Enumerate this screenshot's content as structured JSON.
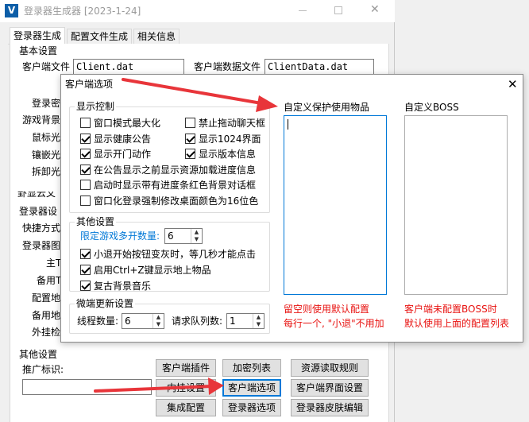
{
  "main_window": {
    "title": "登录器生成器 [2023-1-24]",
    "app_icon_letter": "V",
    "tabs": [
      "登录器生成",
      "配置文件生成",
      "相关信息"
    ],
    "basic_settings_title": "基本设置",
    "client_file_label": "客户端文件",
    "client_file_value": "Client.dat",
    "client_data_label": "客户端数据文件",
    "client_data_value": "ClientData.dat",
    "partial_labels": [
      "登录密",
      "游戏背景",
      "鼠标光",
      "镶嵌光",
      "拆卸光",
      "登录器设",
      "快捷方式",
      "登录器图",
      "主T",
      "备用T",
      "配置地",
      "备用地",
      "外挂检"
    ],
    "cut_section_title": "卦显云文",
    "other_settings_title": "其他设置",
    "promo_label": "推广标识:",
    "buttons": {
      "client_plugin": "客户端插件",
      "encrypt_list": "加密列表",
      "resource_rules": "资源读取规则",
      "inner_settings": "内挂设置",
      "client_options": "客户端选项",
      "client_ui_settings": "客户端界面设置",
      "integrated_config": "集成配置",
      "launcher_options": "登录器选项",
      "launcher_skin_edit": "登录器皮肤编辑"
    }
  },
  "dialog": {
    "title": "客户端选项",
    "display_control": {
      "title": "显示控制",
      "items": [
        {
          "label": "窗口模式最大化",
          "checked": false
        },
        {
          "label": "禁止拖动聊天框",
          "checked": false
        },
        {
          "label": "显示健康公告",
          "checked": true
        },
        {
          "label": "显示1024界面",
          "checked": true
        },
        {
          "label": "显示开门动作",
          "checked": true
        },
        {
          "label": "显示版本信息",
          "checked": true
        },
        {
          "label": "在公告显示之前显示资源加载进度信息",
          "checked": true
        },
        {
          "label": "启动时显示带有进度条红色背景对话框",
          "checked": false
        },
        {
          "label": "窗口化登录强制修改桌面颜色为16位色",
          "checked": false
        }
      ]
    },
    "other_settings": {
      "title": "其他设置",
      "limit_label": "限定游戏多开数量:",
      "limit_value": "6",
      "items": [
        {
          "label": "小退开始按钮变灰时，等几秒才能点击",
          "checked": true
        },
        {
          "label": "启用Ctrl+Z键显示地上物品",
          "checked": true
        },
        {
          "label": "复古背景音乐",
          "checked": true
        }
      ]
    },
    "micro_update": {
      "title": "微端更新设置",
      "threads_label": "线程数量:",
      "threads_value": "6",
      "queue_label": "请求队列数:",
      "queue_value": "1"
    },
    "custom_items": {
      "title": "自定义保护使用物品",
      "hint1": "留空则使用默认配置",
      "hint2": "每行一个, \"小退\"不用加"
    },
    "custom_boss": {
      "title": "自定义BOSS",
      "hint1": "客户端未配置BOSS时",
      "hint2": "默认使用上面的配置列表"
    }
  },
  "colors": {
    "accent_blue": "#0078d7",
    "hint_red": "#e8110f",
    "arrow_red": "#e8353a"
  }
}
